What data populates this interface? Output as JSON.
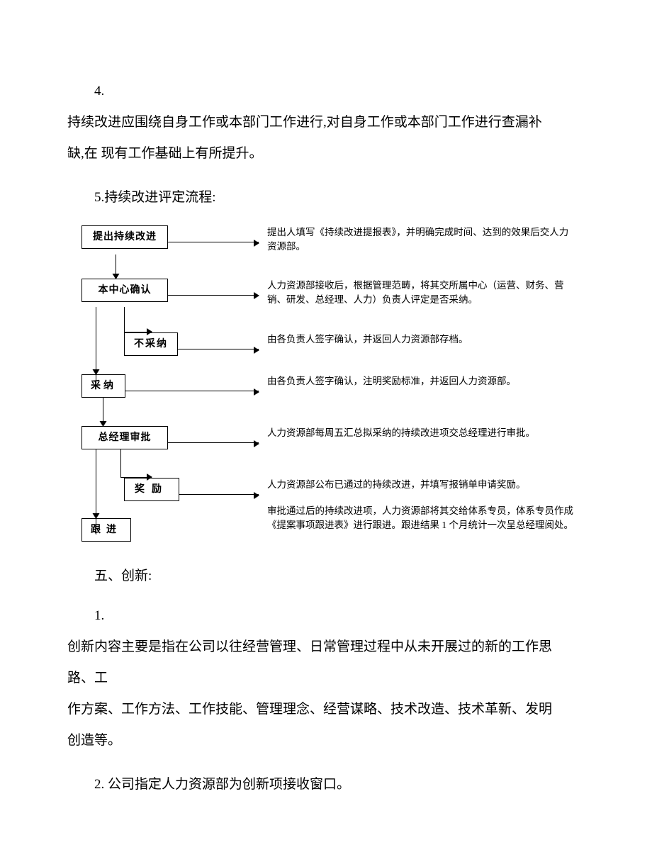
{
  "item4": {
    "num": "4.",
    "text1": "持续改进应围绕自身工作或本部门工作进行,对自身工作或本部门工作进行查漏补",
    "text2": "缺,在 现有工作基础上有所提升。"
  },
  "item5": {
    "text": "5.持续改进评定流程:"
  },
  "flow": {
    "propose": {
      "box": "提出持续改进",
      "desc": "提出人填写《持续改进提报表》，并明确完成时间、达到的效果后交人力资源部。"
    },
    "center": {
      "box": "本中心确认",
      "desc": "人力资源部接收后，根据管理范畴，将其交所属中心（运营、财务、营销、研发、总经理、人力）负责人评定是否采纳。"
    },
    "reject": {
      "box": "不采纳",
      "desc": "由各负责人签字确认，并返回人力资源部存档。"
    },
    "accept": {
      "box": "采纳",
      "desc": "由各负责人签字确认，注明奖励标准，并返回人力资源部。"
    },
    "approve": {
      "box": "总经理审批",
      "desc": "人力资源部每周五汇总拟采纳的持续改进项交总经理进行审批。"
    },
    "reward": {
      "box": "奖励",
      "desc": "人力资源部公布已通过的持续改进，并填写报销单申请奖励。"
    },
    "follow": {
      "box": "跟进",
      "desc": "审批通过后的持续改进项，人力资源部将其交给体系专员，体系专员作成《提案事项跟进表》进行跟进。跟进结果 1 个月统计一次呈总经理阅处。"
    }
  },
  "section5": {
    "heading": "五、创新:"
  },
  "inno1": {
    "num": "1.",
    "l1": "创新内容主要是指在公司以往经营管理、日常管理过程中从未开展过的新的工作思",
    "l2": "路、工",
    "l3": "作方案、工作方法、工作技能、管理理念、经营谋略、技术改造、技术革新、发明",
    "l4": "创造等。"
  },
  "inno2": {
    "text": "2. 公司指定人力资源部为创新项接收窗口。"
  }
}
